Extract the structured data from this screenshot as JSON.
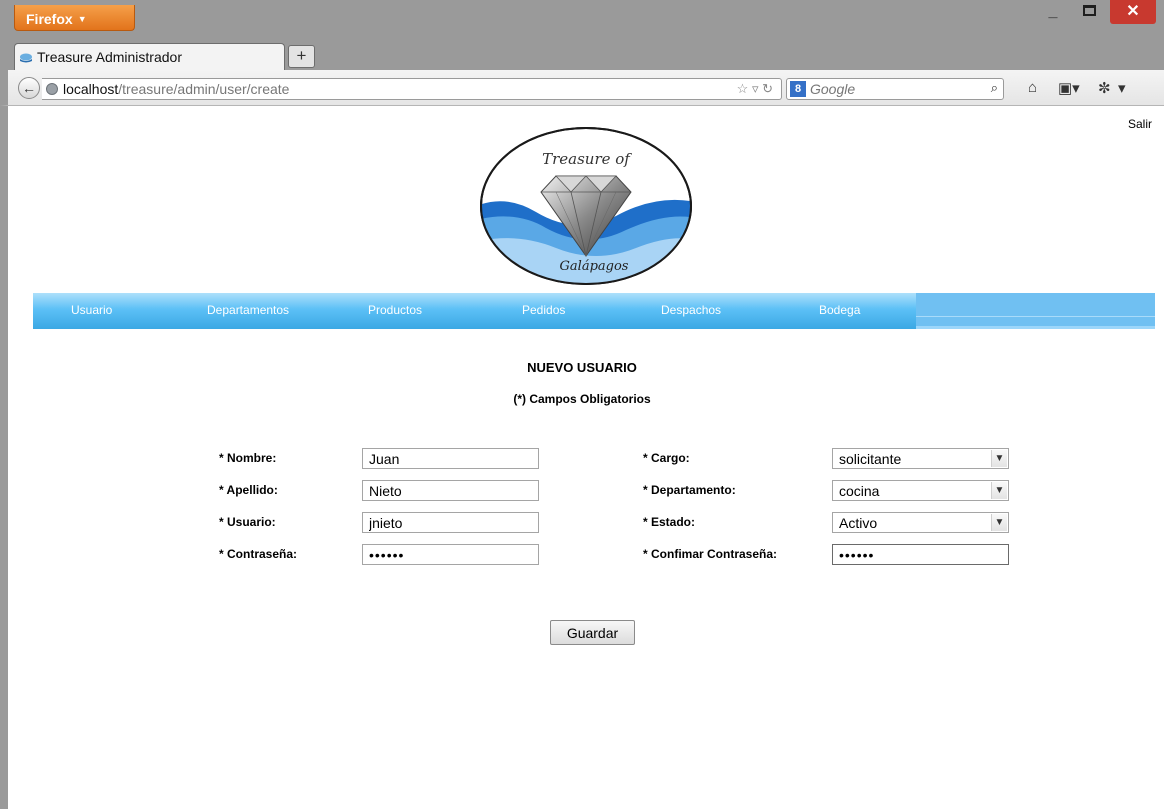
{
  "browser": {
    "app_button_label": "Firefox",
    "tab_title": "Treasure Administrador",
    "new_tab_label": "+",
    "url_host": "localhost",
    "url_path": "/treasure/admin/user/create",
    "search_engine_badge": "8",
    "search_placeholder": "Google",
    "icons": [
      "back-arrow-icon",
      "globe-icon",
      "star-icon",
      "reload-icon",
      "search-icon",
      "home-icon",
      "bookmarks-icon",
      "addon-icon",
      "minimize-icon",
      "maximize-icon",
      "close-icon"
    ]
  },
  "header": {
    "logout_label": "Salir",
    "logo_text_top": "Treasure of",
    "logo_text_bottom": "Galápagos"
  },
  "menu": {
    "items": [
      {
        "label": "Usuario"
      },
      {
        "label": "Departamentos"
      },
      {
        "label": "Productos"
      },
      {
        "label": "Pedidos"
      },
      {
        "label": "Despachos"
      },
      {
        "label": "Bodega"
      }
    ]
  },
  "form": {
    "title": "NUEVO USUARIO",
    "subtitle": "(*) Campos Obligatorios",
    "nombre": {
      "label": "* Nombre:",
      "value": "Juan"
    },
    "apellido": {
      "label": "* Apellido:",
      "value": "Nieto"
    },
    "usuario": {
      "label": "* Usuario:",
      "value": "jnieto"
    },
    "contrasena": {
      "label": "* Contraseña:",
      "value": "••••••"
    },
    "cargo": {
      "label": "* Cargo:",
      "value": "solicitante"
    },
    "departamento": {
      "label": "* Departamento:",
      "value": "cocina"
    },
    "estado": {
      "label": "* Estado:",
      "value": "Activo"
    },
    "confirmar": {
      "label": "* Confimar Contraseña:",
      "value": "••••••"
    },
    "submit_label": "Guardar"
  },
  "colors": {
    "menu_blue": "#5cc0f6",
    "menu_right": "#70c0f2",
    "firefox_orange": "#e2731b",
    "close_red": "#c8392f"
  }
}
